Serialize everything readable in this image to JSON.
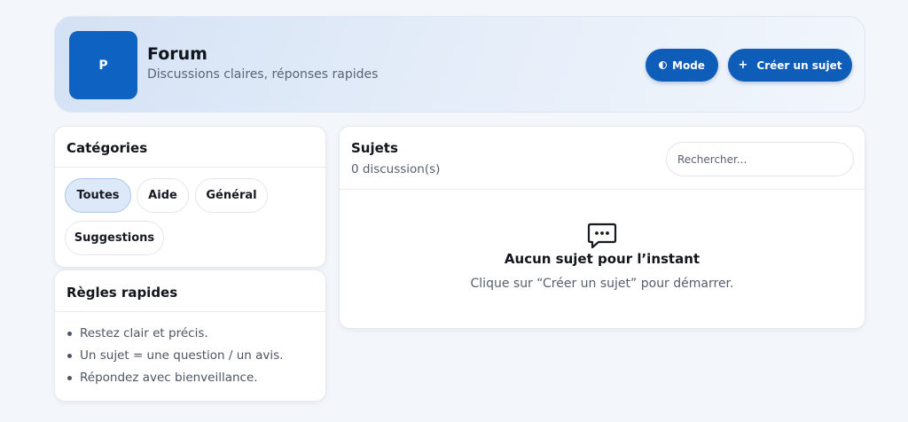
{
  "header": {
    "logo_letter": "P",
    "title": "Forum",
    "subtitle": "Discussions claires, réponses rapides",
    "mode_label": "Mode",
    "mode_icon": "half-moon-icon",
    "create_label": "Créer un sujet",
    "create_icon": "plus-icon"
  },
  "categories": {
    "title": "Catégories",
    "items": [
      {
        "label": "Toutes",
        "active": true
      },
      {
        "label": "Aide",
        "active": false
      },
      {
        "label": "Général",
        "active": false
      },
      {
        "label": "Suggestions",
        "active": false
      }
    ]
  },
  "rules": {
    "title": "Règles rapides",
    "items": [
      "Restez clair et précis.",
      "Un sujet = une question / un avis.",
      "Répondez avec bienveillance."
    ]
  },
  "topics": {
    "title": "Sujets",
    "count_label": "0 discussion(s)",
    "search_placeholder": "Rechercher...",
    "empty_icon": "chat-bubble-icon",
    "empty_title": "Aucun sujet pour l’instant",
    "empty_subtitle": "Clique sur “Créer un sujet” pour démarrer."
  },
  "colors": {
    "accent": "#0e5db9",
    "logo_bg": "#0e63c2",
    "active_chip_bg": "#dde9f8",
    "page_bg": "#f3f6fa"
  }
}
